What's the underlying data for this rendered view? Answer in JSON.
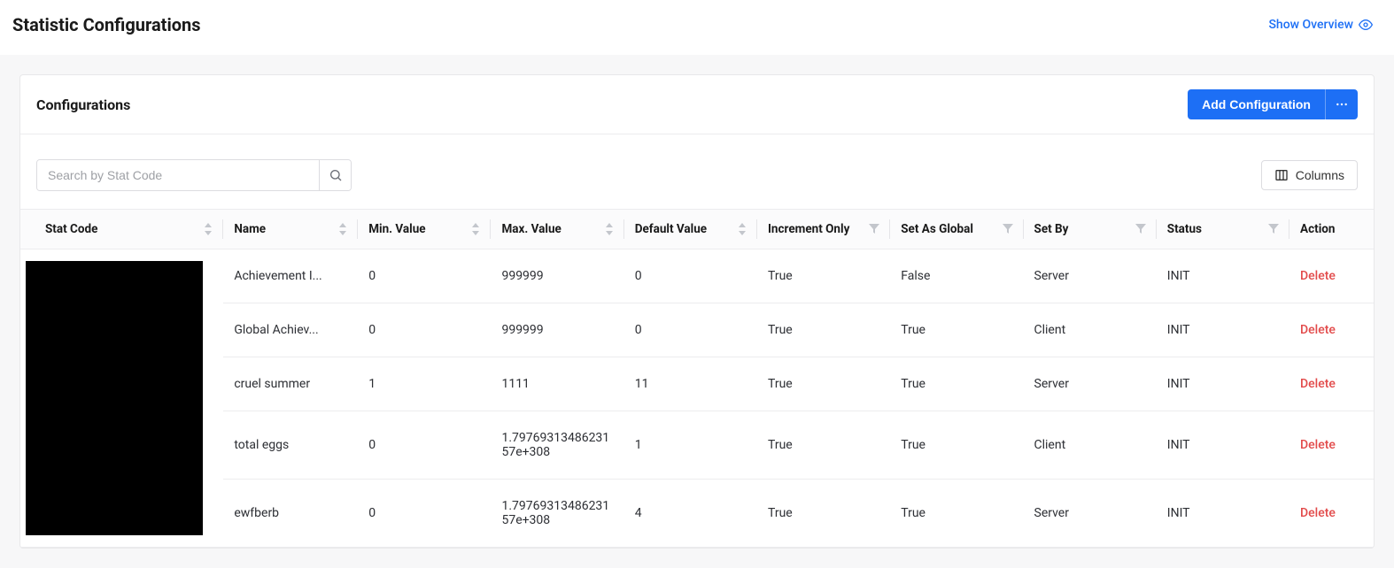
{
  "page": {
    "title": "Statistic Configurations",
    "overview_link": "Show Overview"
  },
  "card": {
    "title": "Configurations",
    "add_btn": "Add Configuration"
  },
  "toolbar": {
    "search_placeholder": "Search by Stat Code",
    "columns_btn": "Columns"
  },
  "table": {
    "headers": {
      "stat_code": "Stat Code",
      "name": "Name",
      "min": "Min. Value",
      "max": "Max. Value",
      "default": "Default Value",
      "inc": "Increment Only",
      "global": "Set As Global",
      "setby": "Set By",
      "status": "Status",
      "action": "Action"
    },
    "rows": [
      {
        "name": "Achievement I...",
        "min": "0",
        "max": "999999",
        "default": "0",
        "inc": "True",
        "global": "False",
        "setby": "Server",
        "status": "INIT",
        "action": "Delete"
      },
      {
        "name": "Global Achiev...",
        "min": "0",
        "max": "999999",
        "default": "0",
        "inc": "True",
        "global": "True",
        "setby": "Client",
        "status": "INIT",
        "action": "Delete"
      },
      {
        "name": "cruel summer",
        "min": "1",
        "max": "1111",
        "default": "11",
        "inc": "True",
        "global": "True",
        "setby": "Server",
        "status": "INIT",
        "action": "Delete"
      },
      {
        "name": "total eggs",
        "min": "0",
        "max": "1.7976931348623157e+308",
        "default": "1",
        "inc": "True",
        "global": "True",
        "setby": "Client",
        "status": "INIT",
        "action": "Delete"
      },
      {
        "name": "ewfberb",
        "min": "0",
        "max": "1.7976931348623157e+308",
        "default": "4",
        "inc": "True",
        "global": "True",
        "setby": "Server",
        "status": "INIT",
        "action": "Delete"
      }
    ]
  }
}
